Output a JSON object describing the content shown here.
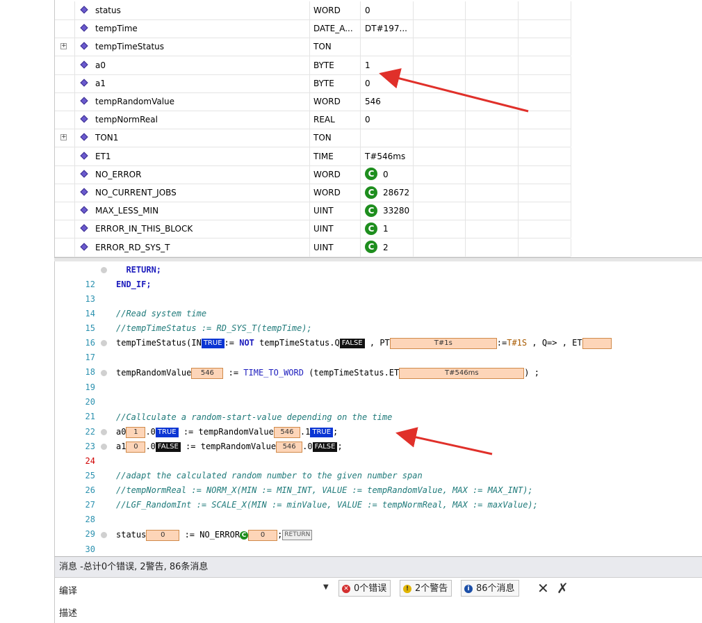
{
  "variables": [
    {
      "name": "status",
      "type": "WORD",
      "value": "0",
      "expandable": false,
      "constant": false
    },
    {
      "name": "tempTime",
      "type": "DATE_A...",
      "value": "DT#197...",
      "expandable": false,
      "constant": false
    },
    {
      "name": "tempTimeStatus",
      "type": "TON",
      "value": "",
      "expandable": true,
      "constant": false
    },
    {
      "name": "a0",
      "type": "BYTE",
      "value": "1",
      "expandable": false,
      "constant": false
    },
    {
      "name": "a1",
      "type": "BYTE",
      "value": "0",
      "expandable": false,
      "constant": false
    },
    {
      "name": "tempRandomValue",
      "type": "WORD",
      "value": "546",
      "expandable": false,
      "constant": false
    },
    {
      "name": "tempNormReal",
      "type": "REAL",
      "value": "0",
      "expandable": false,
      "constant": false
    },
    {
      "name": "TON1",
      "type": "TON",
      "value": "",
      "expandable": true,
      "constant": false
    },
    {
      "name": "ET1",
      "type": "TIME",
      "value": "T#546ms",
      "expandable": false,
      "constant": false
    },
    {
      "name": "NO_ERROR",
      "type": "WORD",
      "value": "0",
      "expandable": false,
      "constant": true
    },
    {
      "name": "NO_CURRENT_JOBS",
      "type": "WORD",
      "value": "28672",
      "expandable": false,
      "constant": true
    },
    {
      "name": "MAX_LESS_MIN",
      "type": "UINT",
      "value": "33280",
      "expandable": false,
      "constant": true
    },
    {
      "name": "ERROR_IN_THIS_BLOCK",
      "type": "UINT",
      "value": "1",
      "expandable": false,
      "constant": true
    },
    {
      "name": "ERROR_RD_SYS_T",
      "type": "UINT",
      "value": "2",
      "expandable": false,
      "constant": true
    }
  ],
  "constant_badge": "C",
  "expand_glyph": "+",
  "code": {
    "line_numbers": [
      "12",
      "13",
      "14",
      "15",
      "16",
      "17",
      "18",
      "19",
      "20",
      "21",
      "22",
      "23",
      "24",
      "25",
      "26",
      "27",
      "28",
      "29",
      "30"
    ],
    "l12": "RETURN;",
    "l13": "END_IF;",
    "l15": "//Read system time",
    "l16": "//tempTimeStatus := RD_SYS_T(tempTime);",
    "l17_a": "tempTimeStatus(IN",
    "l17_true": "TRUE",
    "l17_b": ":= ",
    "l17_not": "NOT",
    "l17_c": " tempTimeStatus.Q",
    "l17_false": "FALSE",
    "l17_d": " , PT",
    "l17_t1s": "T#1s",
    "l17_e": ":=",
    "l17_f": "T#1S",
    "l17_g": " , Q=> , ET",
    "l19_a": "tempRandomValue",
    "l19_v": "546",
    "l19_b": " := ",
    "l19_fn": "TIME_TO_WORD",
    "l19_c": " (tempTimeStatus.ET",
    "l19_t": "T#546ms",
    "l19_d": ") ;",
    "l22": "//Callculate a random-start-value depending on the time",
    "l23_a": "a0",
    "l23_v": "1",
    "l23_b": ".0",
    "l23_t": "TRUE",
    "l23_c": " := tempRandomValue",
    "l23_v2": "546",
    "l23_d": ".1",
    "l23_t2": "TRUE",
    "l23_e": ";",
    "l24_a": "a1",
    "l24_v": "0",
    "l24_b": ".0",
    "l24_f": "FALSE",
    "l24_c": " := tempRandomValue",
    "l24_v2": "546",
    "l24_d": ".0",
    "l24_f2": "FALSE",
    "l24_e": ";",
    "l26": "//adapt the calculated random number to the given number span",
    "l27": "//tempNormReal := NORM_X(MIN := MIN_INT, VALUE := tempRandomValue, MAX := MAX_INT);",
    "l28": "//LGF_RandomInt := SCALE_X(MIN := minValue, VALUE := tempNormReal, MAX := maxValue);",
    "l30_a": "status",
    "l30_v": "0",
    "l30_b": " := NO_ERROR",
    "l30_c": "C",
    "l30_v2": "0",
    "l30_d": ";",
    "l30_ret": "RETURN"
  },
  "messages": {
    "title": "消息 -总计0个错误, 2警告, 86条消息",
    "compile_label": "编译",
    "errors_label": "0个错误",
    "warnings_label": "2个警告",
    "info_label": "86个消息",
    "description_label": "描述"
  },
  "colors": {
    "accent_true": "#0b35d3",
    "constant_green": "#1e8e1e",
    "arrow_red": "#e0302a"
  }
}
